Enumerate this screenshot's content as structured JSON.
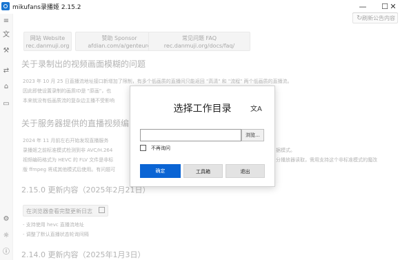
{
  "window": {
    "title": "mikufans录播姬 2.15.2",
    "min_glyph": "—",
    "max_glyph": "☐",
    "close_glyph": "✕"
  },
  "sidebar": {
    "icons": [
      "translate-icon",
      "wrench-icon",
      "sync-icon",
      "tag-icon",
      "archive-icon",
      "settings-icon",
      "bug-icon",
      "info-icon"
    ]
  },
  "toolbar": {
    "refresh_label": "刷新公告内容",
    "refresh_icon": "↻"
  },
  "links": [
    {
      "title": "网站 Website",
      "url": "rec.danmuji.org"
    },
    {
      "title": "赞助 Sponsor",
      "url": "afdian.com/a/genteure"
    },
    {
      "title": "常见问题 FAQ",
      "url": "rec.danmuji.org/docs/faq/"
    }
  ],
  "section1": {
    "heading": "关于录制出的视频画面模糊的问题",
    "lines": [
      "2023 年 10 月 25 日直播流地址接口新增加了限制，有多个低画质的直播间只能返回 \"高清\" 和 \"流程\" 两个低画质的直播流。",
      "因此即使设置录制的画质ID是 \"原画\"，也",
      "本来就没有低画质流的复杂边主播不受影响"
    ]
  },
  "section2": {
    "heading": "关于服务器提供的直播视频编",
    "lines": [
      "2024 年 11 月前左右开始发现直播服务",
      "录播姬之前标准模式检测到非 AVC/H.264",
      "视频编码格式为 HEVC 的 FLV 文件是非标",
      "版 ffmpeg 将成其他模式后使用。有问题可"
    ],
    "right_fragments": [
      "据模式。",
      "分播放器读取，需用支持这个非标准模式的魔改"
    ]
  },
  "changelog": {
    "heading_215": "2.15.0 更新内容（2025年2月21日）",
    "open_label": "在浏览器查看完整更新日志",
    "notes": [
      "- 支持使用 hevc 直播流地址",
      "- 调整了默认直播状态轮询间隔"
    ],
    "heading_214": "2.14.0 更新内容（2025年1月3日）"
  },
  "dialog": {
    "title": "选择工作目录",
    "lang_icon_glyph": "文A",
    "path_value": "",
    "browse_label": "浏览...",
    "no_ask_label": "不再询问",
    "no_ask_checked": false,
    "ok_label": "确定",
    "tools_label": "工具箱",
    "exit_label": "退出"
  }
}
